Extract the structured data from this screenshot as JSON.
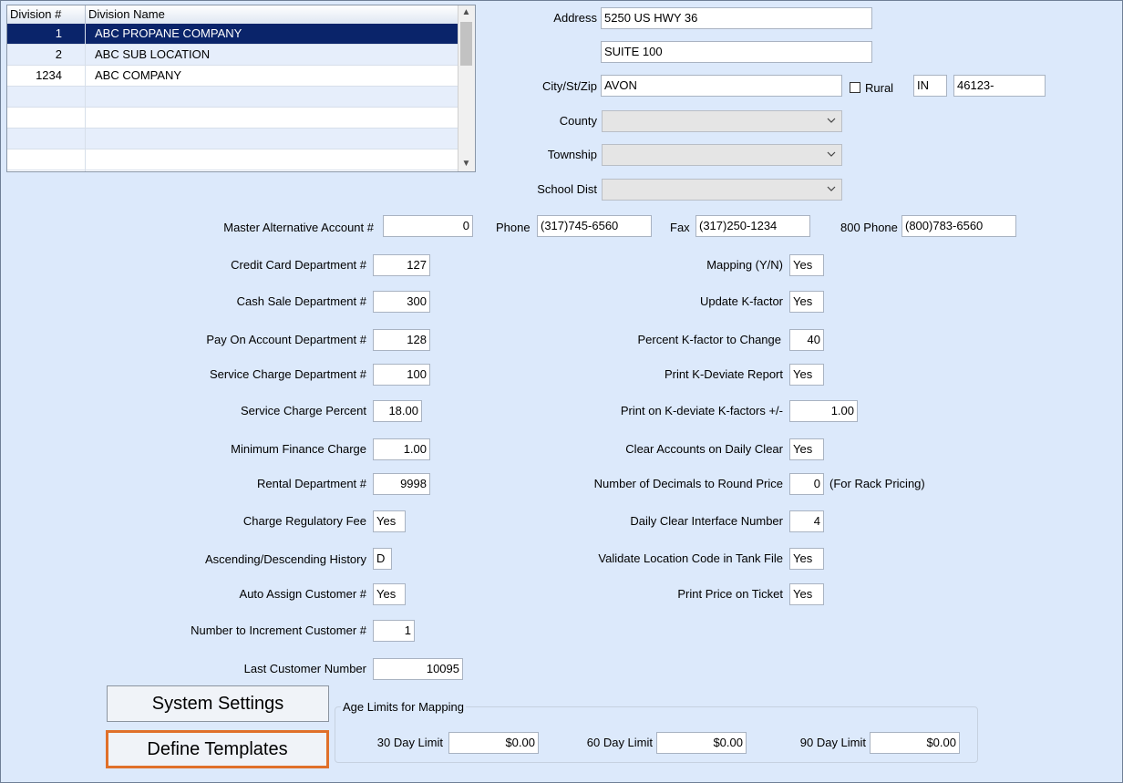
{
  "grid": {
    "headers": {
      "division_num": "Division #",
      "division_name": "Division Name"
    },
    "rows": [
      {
        "num": "1",
        "name": "ABC PROPANE COMPANY",
        "selected": true
      },
      {
        "num": "2",
        "name": "ABC SUB LOCATION",
        "selected": false
      },
      {
        "num": "1234",
        "name": "ABC COMPANY",
        "selected": false
      },
      {
        "num": "",
        "name": "",
        "selected": false
      },
      {
        "num": "",
        "name": "",
        "selected": false
      },
      {
        "num": "",
        "name": "",
        "selected": false
      },
      {
        "num": "",
        "name": "",
        "selected": false
      }
    ]
  },
  "address": {
    "address_label": "Address",
    "address_line1": "5250 US HWY 36",
    "address_line2": "SUITE 100",
    "city_label": "City/St/Zip",
    "city": "AVON",
    "rural_label": "Rural",
    "state": "IN",
    "zip": "46123-",
    "county_label": "County",
    "county_value": "",
    "township_label": "Township",
    "township_value": "",
    "school_label": "School Dist",
    "school_value": ""
  },
  "contact": {
    "master_alt_label": "Master Alternative Account #",
    "master_alt_value": "0",
    "phone_label": "Phone",
    "phone_value": "(317)745-6560",
    "fax_label": "Fax",
    "fax_value": "(317)250-1234",
    "phone800_label": "800 Phone",
    "phone800_value": "(800)783-6560"
  },
  "left_fields": [
    {
      "label": "Credit Card Department #",
      "value": "127"
    },
    {
      "label": "Cash Sale Department #",
      "value": "300"
    },
    {
      "label": "Pay On Account Department #",
      "value": "128"
    },
    {
      "label": "Service Charge Department #",
      "value": "100"
    },
    {
      "label": "Service Charge Percent",
      "value": "18.00"
    },
    {
      "label": "Minimum Finance Charge",
      "value": "1.00"
    },
    {
      "label": "Rental Department #",
      "value": "9998"
    },
    {
      "label": "Charge Regulatory Fee",
      "value": "Yes"
    },
    {
      "label": "Ascending/Descending History",
      "value": "D"
    },
    {
      "label": "Auto Assign Customer #",
      "value": "Yes"
    },
    {
      "label": "Number to Increment Customer #",
      "value": "1"
    },
    {
      "label": "Last Customer Number",
      "value": "10095"
    }
  ],
  "right_fields": [
    {
      "label": "Mapping (Y/N)",
      "value": "Yes"
    },
    {
      "label": "Update K-factor",
      "value": "Yes"
    },
    {
      "label": "Percent K-factor to Change",
      "value": "40"
    },
    {
      "label": "Print K-Deviate Report",
      "value": "Yes"
    },
    {
      "label": "Print on K-deviate K-factors +/-",
      "value": "1.00"
    },
    {
      "label": "Clear Accounts on Daily Clear",
      "value": "Yes"
    },
    {
      "label": "Number of Decimals to Round Price",
      "value": "0"
    },
    {
      "label": "Daily Clear Interface Number",
      "value": "4"
    },
    {
      "label": "Validate Location Code in Tank File",
      "value": "Yes"
    },
    {
      "label": "Print Price on Ticket",
      "value": "Yes"
    }
  ],
  "rack_pricing_note": "(For Rack Pricing)",
  "buttons": {
    "system_settings": "System Settings",
    "define_templates": "Define Templates"
  },
  "age_limits": {
    "title": "Age Limits for Mapping",
    "limit30_label": "30 Day Limit",
    "limit30_value": "$0.00",
    "limit60_label": "60 Day Limit",
    "limit60_value": "$0.00",
    "limit90_label": "90 Day Limit",
    "limit90_value": "$0.00"
  },
  "colors": {
    "background": "#dce9fb",
    "selected_row": "#0a246a",
    "highlight_border": "#e0702a"
  }
}
